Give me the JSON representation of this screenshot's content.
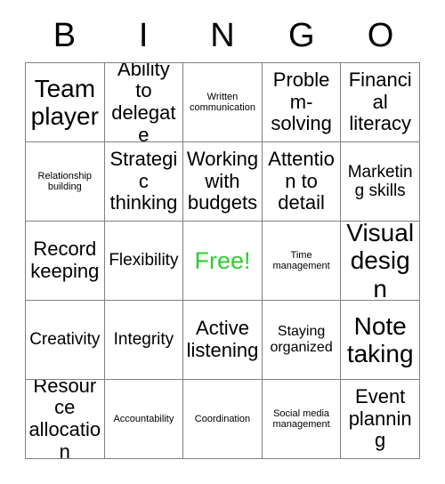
{
  "card": {
    "title": "BINGO",
    "headers": [
      "B",
      "I",
      "N",
      "G",
      "O"
    ],
    "free_color": "#33cc33",
    "border_color": "#808080",
    "text_color": "#000000",
    "rows": [
      [
        {
          "label": "Team player",
          "size": "xl",
          "free": false
        },
        {
          "label": "Ability to delegate",
          "size": "lg",
          "free": false
        },
        {
          "label": "Written communication",
          "size": "xs",
          "free": false
        },
        {
          "label": "Problem-solving",
          "size": "lg",
          "free": false
        },
        {
          "label": "Financial literacy",
          "size": "lg",
          "free": false
        }
      ],
      [
        {
          "label": "Relationship building",
          "size": "xs",
          "free": false
        },
        {
          "label": "Strategic thinking",
          "size": "lg",
          "free": false
        },
        {
          "label": "Working with budgets",
          "size": "lg",
          "free": false
        },
        {
          "label": "Attention to detail",
          "size": "lg",
          "free": false
        },
        {
          "label": "Marketing skills",
          "size": "md",
          "free": false
        }
      ],
      [
        {
          "label": "Record keeping",
          "size": "lg",
          "free": false
        },
        {
          "label": "Flexibility",
          "size": "md",
          "free": false
        },
        {
          "label": "Free!",
          "size": "xl",
          "free": true
        },
        {
          "label": "Time management",
          "size": "xs",
          "free": false
        },
        {
          "label": "Visual design",
          "size": "xl",
          "free": false
        }
      ],
      [
        {
          "label": "Creativity",
          "size": "md",
          "free": false
        },
        {
          "label": "Integrity",
          "size": "md",
          "free": false
        },
        {
          "label": "Active listening",
          "size": "lg",
          "free": false
        },
        {
          "label": "Staying organized",
          "size": "sm",
          "free": false
        },
        {
          "label": "Note taking",
          "size": "xl",
          "free": false
        }
      ],
      [
        {
          "label": "Resource allocation",
          "size": "lg",
          "free": false
        },
        {
          "label": "Accountability",
          "size": "xs",
          "free": false
        },
        {
          "label": "Coordination",
          "size": "xs",
          "free": false
        },
        {
          "label": "Social media management",
          "size": "xs",
          "free": false
        },
        {
          "label": "Event planning",
          "size": "lg",
          "free": false
        }
      ]
    ]
  }
}
